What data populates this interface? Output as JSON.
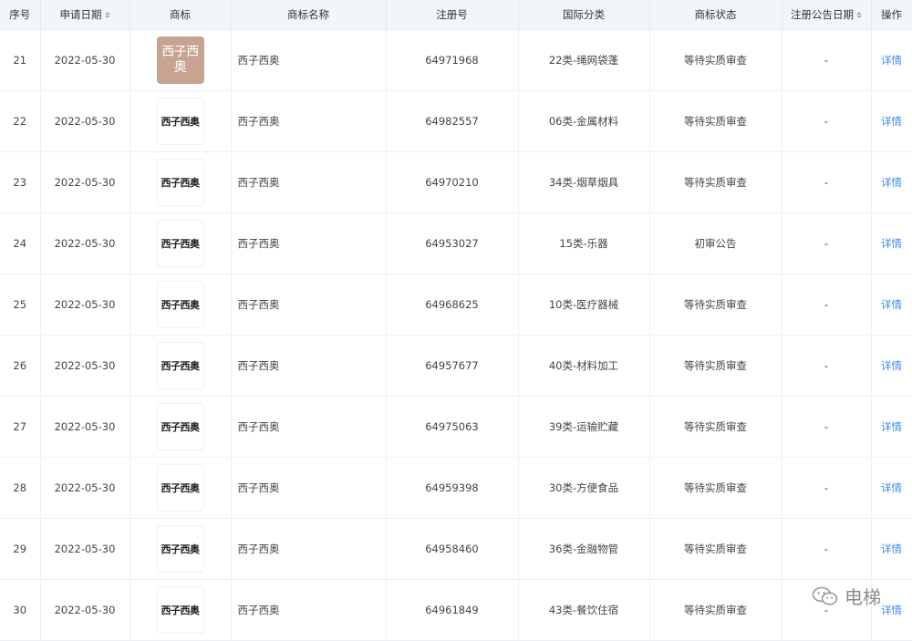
{
  "header": {
    "seq": "序号",
    "apply_date": "申请日期",
    "logo": "商标",
    "name": "商标名称",
    "reg_no": "注册号",
    "intl_class": "国际分类",
    "status": "商标状态",
    "announce_date": "注册公告日期",
    "action": "操作"
  },
  "rows": [
    {
      "seq": "21",
      "date": "2022-05-30",
      "logo": "西子西奥",
      "name": "西子西奥",
      "reg": "64971968",
      "cls": "22类-绳网袋蓬",
      "status": "等待实质审查",
      "announce": "-",
      "action": "详情"
    },
    {
      "seq": "22",
      "date": "2022-05-30",
      "logo": "西子西奥",
      "name": "西子西奥",
      "reg": "64982557",
      "cls": "06类-金属材料",
      "status": "等待实质审查",
      "announce": "-",
      "action": "详情"
    },
    {
      "seq": "23",
      "date": "2022-05-30",
      "logo": "西子西奥",
      "name": "西子西奥",
      "reg": "64970210",
      "cls": "34类-烟草烟具",
      "status": "等待实质审查",
      "announce": "-",
      "action": "详情"
    },
    {
      "seq": "24",
      "date": "2022-05-30",
      "logo": "西子西奥",
      "name": "西子西奥",
      "reg": "64953027",
      "cls": "15类-乐器",
      "status": "初审公告",
      "announce": "-",
      "action": "详情"
    },
    {
      "seq": "25",
      "date": "2022-05-30",
      "logo": "西子西奥",
      "name": "西子西奥",
      "reg": "64968625",
      "cls": "10类-医疗器械",
      "status": "等待实质审查",
      "announce": "-",
      "action": "详情"
    },
    {
      "seq": "26",
      "date": "2022-05-30",
      "logo": "西子西奥",
      "name": "西子西奥",
      "reg": "64957677",
      "cls": "40类-材料加工",
      "status": "等待实质审查",
      "announce": "-",
      "action": "详情"
    },
    {
      "seq": "27",
      "date": "2022-05-30",
      "logo": "西子西奥",
      "name": "西子西奥",
      "reg": "64975063",
      "cls": "39类-运输贮藏",
      "status": "等待实质审查",
      "announce": "-",
      "action": "详情"
    },
    {
      "seq": "28",
      "date": "2022-05-30",
      "logo": "西子西奥",
      "name": "西子西奥",
      "reg": "64959398",
      "cls": "30类-方便食品",
      "status": "等待实质审查",
      "announce": "-",
      "action": "详情"
    },
    {
      "seq": "29",
      "date": "2022-05-30",
      "logo": "西子西奥",
      "name": "西子西奥",
      "reg": "64958460",
      "cls": "36类-金融物管",
      "status": "等待实质审查",
      "announce": "-",
      "action": "详情"
    },
    {
      "seq": "30",
      "date": "2022-05-30",
      "logo": "西子西奥",
      "name": "西子西奥",
      "reg": "64961849",
      "cls": "43类-餐饮住宿",
      "status": "等待实质审查",
      "announce": "-",
      "action": "详情"
    }
  ],
  "watermark": {
    "text": "电梯",
    "icon": "wechat-icon"
  },
  "colors": {
    "link": "#3a88e8",
    "header_bg": "#f2f6fa",
    "logo_bg": "#c7a492"
  }
}
